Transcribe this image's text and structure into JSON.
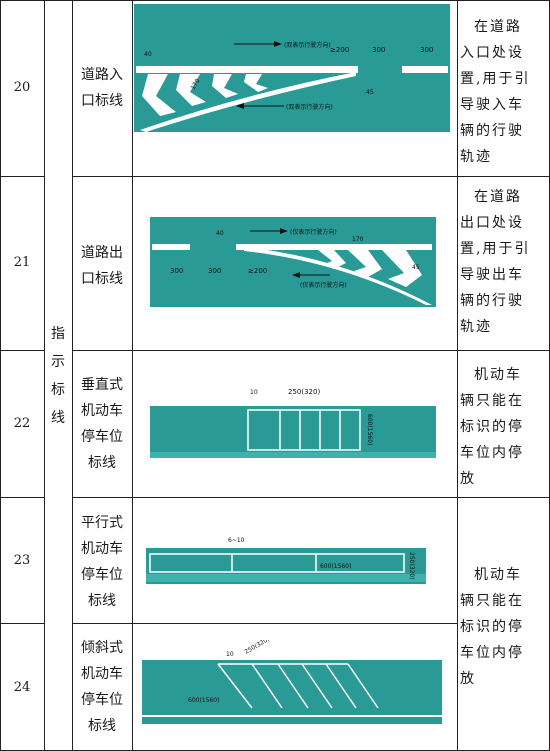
{
  "category": "指\n示\n标\n线",
  "rows": [
    {
      "num": "20",
      "name": [
        "道路入",
        "口标线"
      ],
      "desc": [
        "在道路",
        "入口处设",
        "置,用于引",
        "导驶入车",
        "辆的行驶",
        "轨迹"
      ],
      "labels": {
        "dir_top": "(双表示行驶方向)",
        "ge200": "≥200",
        "s300a": "300",
        "s300b": "300",
        "dir_bottom": "(双表示行驶方向)",
        "d40": "40",
        "d170": "170",
        "d45": "45"
      }
    },
    {
      "num": "21",
      "name": [
        "道路出",
        "口标线"
      ],
      "desc": [
        "在道路",
        "出口处设",
        "置,用于引",
        "导驶出车",
        "辆的行驶",
        "轨迹"
      ],
      "labels": {
        "dir_top": "(仅表示行驶方向)",
        "dir_bottom": "(仅表示行驶方向)",
        "s300a": "300",
        "s300b": "300",
        "ge200": "≥200",
        "d40": "40",
        "d170": "170",
        "d45": "45"
      }
    },
    {
      "num": "22",
      "name": [
        "垂直式",
        "机动车",
        "停车位",
        "标线"
      ],
      "desc": [
        "机动车",
        "辆只能在",
        "标识的停",
        "车位内停",
        "放"
      ],
      "labels": {
        "w": "250(320)",
        "h": "600(1560)",
        "t": "10"
      }
    },
    {
      "num": "23",
      "name": [
        "平行式",
        "机动车",
        "停车位",
        "标线"
      ],
      "labels": {
        "t": "6~10",
        "w": "600(1560)",
        "h": "250(320)"
      }
    },
    {
      "num": "24",
      "name": [
        "倾斜式",
        "机动车",
        "停车位",
        "标线"
      ],
      "labels": {
        "t": "10",
        "w": "250(320)",
        "h": "600(1560)"
      }
    }
  ],
  "desc_shared_23_24": [
    "机动车",
    "辆只能在",
    "标识的停",
    "车位内停",
    "放"
  ],
  "colors": {
    "road": "#2a9a96",
    "mark": "#ffffff",
    "ink": "#1a1a1a"
  }
}
